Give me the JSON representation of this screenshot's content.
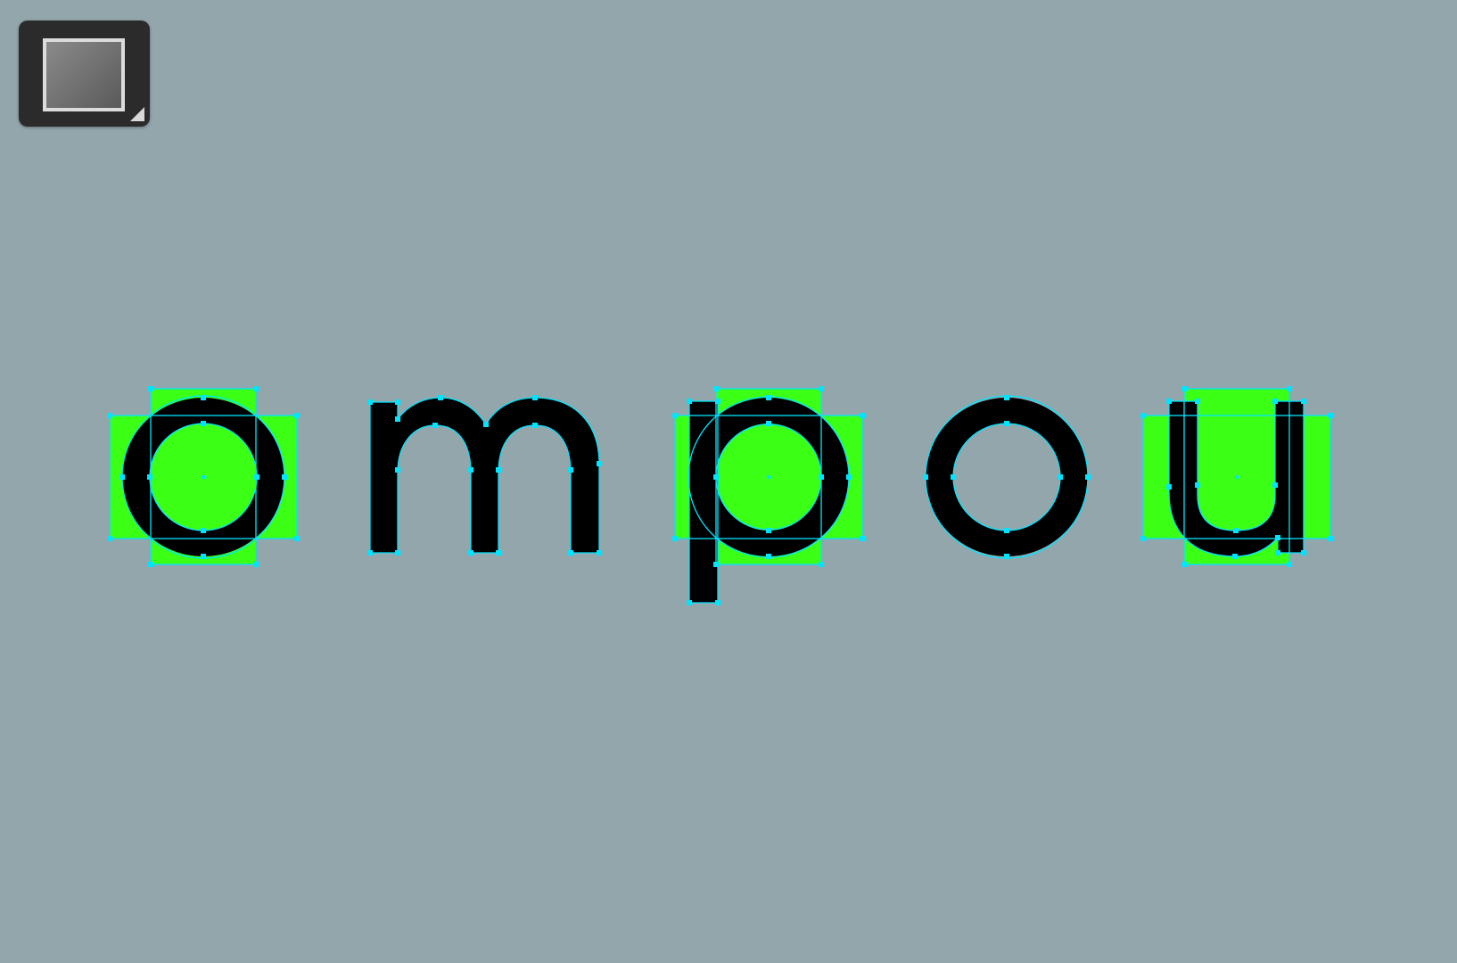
{
  "tool": {
    "icon": "rectangle-shape-tool-icon",
    "swatch_color": "#6e6e6e"
  },
  "canvas": {
    "text": "ompou",
    "colors": {
      "background": "#93a6ab",
      "glyph": "#000000",
      "selection_fill": "#3cff16",
      "anchor_handles": "#00e5ff"
    },
    "glyphs": [
      {
        "char": "o",
        "selected": true
      },
      {
        "char": "m",
        "selected": false
      },
      {
        "char": "p",
        "selected": true
      },
      {
        "char": "o",
        "selected": false
      },
      {
        "char": "u",
        "selected": true
      }
    ]
  }
}
